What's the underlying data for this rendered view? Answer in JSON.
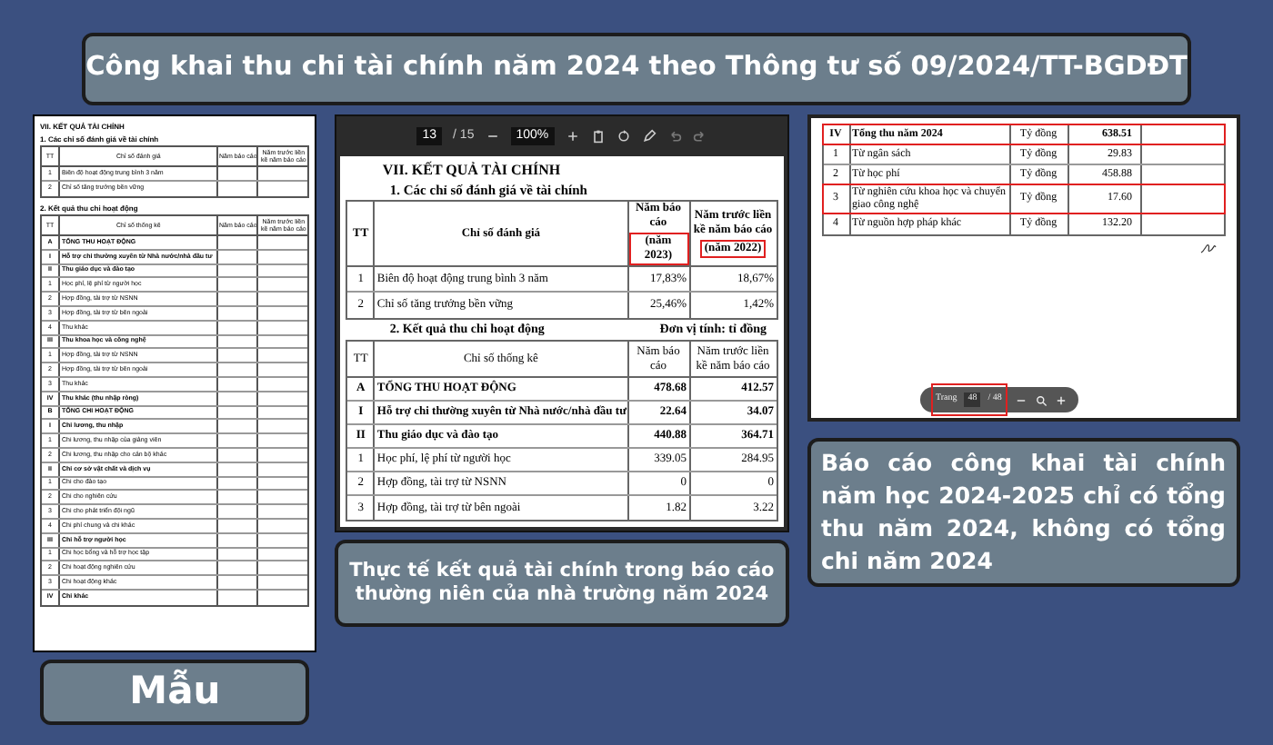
{
  "title": "Công khai thu chi tài chính năm 2024 theo Thông tư số 09/2024/TT-BGDĐT",
  "template_form": {
    "heading": "VII. KẾT QUẢ TÀI CHÍNH",
    "section_1": "1. Các chỉ số đánh giá về tài chính",
    "table_1": {
      "columns": [
        "TT",
        "Chỉ số đánh giá",
        "Năm báo cáo",
        "Năm trước liền kề năm báo cáo"
      ],
      "rows": [
        {
          "kind": "item",
          "no": "1",
          "label": "Biên độ hoạt động trung bình 3 năm"
        },
        {
          "kind": "item",
          "no": "2",
          "label": "Chỉ số tăng trưởng bền vững"
        }
      ]
    },
    "section_2": "2. Kết quả thu chi hoạt động",
    "table_2": {
      "columns": [
        "TT",
        "Chỉ số thống kê",
        "Năm báo cáo",
        "Năm trước liền kề năm báo cáo"
      ],
      "rows": [
        {
          "kind": "group",
          "no": "A",
          "label": "TỔNG THU HOẠT ĐỘNG"
        },
        {
          "kind": "group",
          "no": "I",
          "label": "Hỗ trợ chi thường xuyên từ Nhà nước/nhà đầu tư"
        },
        {
          "kind": "group",
          "no": "II",
          "label": "Thu giáo dục và đào tạo"
        },
        {
          "kind": "item",
          "no": "1",
          "label": "Học phí, lệ phí từ người học"
        },
        {
          "kind": "item",
          "no": "2",
          "label": "Hợp đồng, tài trợ từ NSNN"
        },
        {
          "kind": "item",
          "no": "3",
          "label": "Hợp đồng, tài trợ từ bên ngoài"
        },
        {
          "kind": "item",
          "no": "4",
          "label": "Thu khác"
        },
        {
          "kind": "group",
          "no": "III",
          "label": "Thu khoa học và công nghệ"
        },
        {
          "kind": "item",
          "no": "1",
          "label": "Hợp đồng, tài trợ từ NSNN"
        },
        {
          "kind": "item",
          "no": "2",
          "label": "Hợp đồng, tài trợ từ bên ngoài"
        },
        {
          "kind": "item",
          "no": "3",
          "label": "Thu khác"
        },
        {
          "kind": "group",
          "no": "IV",
          "label": "Thu khác (thu nhập ròng)"
        },
        {
          "kind": "group",
          "no": "B",
          "label": "TỔNG CHI HOẠT ĐỘNG"
        },
        {
          "kind": "group",
          "no": "I",
          "label": "Chi lương, thu nhập"
        },
        {
          "kind": "item",
          "no": "1",
          "label": "Chi lương, thu nhập của giảng viên"
        },
        {
          "kind": "item",
          "no": "2",
          "label": "Chi lương, thu nhập cho cán bộ khác"
        },
        {
          "kind": "group",
          "no": "II",
          "label": "Chi cơ sở vật chất và dịch vụ"
        },
        {
          "kind": "item",
          "no": "1",
          "label": "Chi cho đào tạo"
        },
        {
          "kind": "item",
          "no": "2",
          "label": "Chi cho nghiên cứu"
        },
        {
          "kind": "item",
          "no": "3",
          "label": "Chi cho phát triển đội ngũ"
        },
        {
          "kind": "item",
          "no": "4",
          "label": "Chi phí chung và chi khác"
        },
        {
          "kind": "group",
          "no": "III",
          "label": "Chi hỗ trợ người học"
        },
        {
          "kind": "item",
          "no": "1",
          "label": "Chi học bổng và hỗ trợ học tập"
        },
        {
          "kind": "item",
          "no": "2",
          "label": "Chi hoạt động nghiên cứu"
        },
        {
          "kind": "item",
          "no": "3",
          "label": "Chi hoạt động khác"
        },
        {
          "kind": "group",
          "no": "IV",
          "label": "Chi khác"
        }
      ]
    }
  },
  "template_caption": "Mẫu",
  "report_viewer": {
    "page": "13",
    "page_total": "/ 15",
    "zoom": "100%",
    "heading": "VII. KẾT QUẢ TÀI CHÍNH",
    "section_1": "1. Các chỉ số đánh giá về tài chính",
    "table_1": {
      "columns": [
        {
          "label": "TT"
        },
        {
          "label": "Chỉ số đánh giá"
        },
        {
          "label": "Năm báo cáo",
          "note": "(năm 2023)",
          "highlighted": true
        },
        {
          "label": "Năm trước liền kề năm báo cáo",
          "note": "(năm 2022)",
          "highlighted": true
        }
      ],
      "rows": [
        {
          "kind": "item",
          "no": "1",
          "label": "Biên độ hoạt động trung bình 3 năm",
          "value_1": "17,83%",
          "value_2": "18,67%"
        },
        {
          "kind": "item",
          "no": "2",
          "label": "Chỉ số tăng trưởng bền vững",
          "value_1": "25,46%",
          "value_2": "1,42%"
        }
      ]
    },
    "section_2": "2. Kết quả thu chi hoạt động",
    "unit": "Đơn vị tính: tỉ đồng",
    "table_2": {
      "columns": [
        {
          "label": "TT"
        },
        {
          "label": "Chỉ số thống kê"
        },
        {
          "label": "Năm báo cáo"
        },
        {
          "label": "Năm trước liền kề năm báo cáo"
        }
      ],
      "rows": [
        {
          "kind": "group",
          "no": "A",
          "label": "TỔNG THU HOẠT ĐỘNG",
          "value_1": "478.68",
          "value_2": "412.57"
        },
        {
          "kind": "group",
          "no": "I",
          "label": "Hỗ trợ chi thường xuyên từ Nhà nước/nhà đầu tư",
          "value_1": "22.64",
          "value_2": "34.07"
        },
        {
          "kind": "group",
          "no": "II",
          "label": "Thu giáo dục và đào tạo",
          "value_1": "440.88",
          "value_2": "364.71"
        },
        {
          "kind": "item",
          "no": "1",
          "label": "Học phí, lệ phí từ người học",
          "value_1": "339.05",
          "value_2": "284.95"
        },
        {
          "kind": "item",
          "no": "2",
          "label": "Hợp đồng, tài trợ từ NSNN",
          "value_1": "0",
          "value_2": "0"
        },
        {
          "kind": "item",
          "no": "3",
          "label": "Hợp đồng, tài trợ từ bên ngoài",
          "value_1": "1.82",
          "value_2": "3.22"
        }
      ]
    }
  },
  "report_caption": "Thực tế kết quả tài chính trong báo cáo thường niên của nhà trường năm 2024",
  "disclosure_page": {
    "rows": [
      {
        "kind": "group",
        "no": "IV",
        "label": "Tổng thu năm 2024",
        "unit": "Tỷ đồng",
        "value": "638.51",
        "highlighted": true
      },
      {
        "kind": "item",
        "no": "1",
        "label": "Từ ngân sách",
        "unit": "Tỷ đồng",
        "value": "29.83",
        "highlighted": false
      },
      {
        "kind": "item",
        "no": "2",
        "label": "Từ học phí",
        "unit": "Tỷ đồng",
        "value": "458.88",
        "highlighted": false
      },
      {
        "kind": "item",
        "no": "3",
        "label": "Từ nghiên cứu khoa học và chuyển giao công nghệ",
        "unit": "Tỷ đồng",
        "value": "17.60",
        "highlighted": true
      },
      {
        "kind": "item",
        "no": "4",
        "label": "Từ nguồn hợp pháp khác",
        "unit": "Tỷ đồng",
        "value": "132.20",
        "highlighted": false
      }
    ],
    "page_bar": {
      "label": "Trang",
      "page": "48",
      "page_total": "/ 48",
      "highlighted": true
    }
  },
  "disclosure_caption": "Báo cáo công khai tài chính năm học 2024-2025 chỉ có tổng thu năm 2024, không có tổng chi năm 2024"
}
